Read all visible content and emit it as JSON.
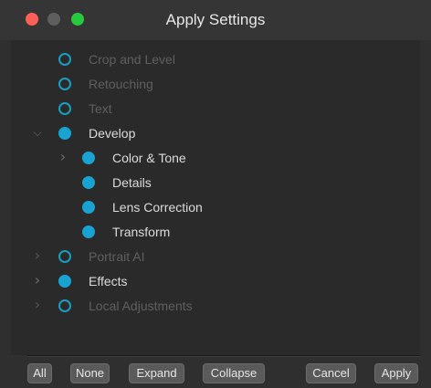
{
  "window": {
    "title": "Apply Settings"
  },
  "colors": {
    "accent": "#18a3d1",
    "close": "#ff5f57",
    "minimize_inactive": "#5e5e5e",
    "maximize": "#28c840"
  },
  "tree": {
    "items": [
      {
        "label": "Crop and Level",
        "state": "unchecked",
        "expander": "none",
        "enabled": false
      },
      {
        "label": "Retouching",
        "state": "unchecked",
        "expander": "none",
        "enabled": false
      },
      {
        "label": "Text",
        "state": "unchecked",
        "expander": "none",
        "enabled": false
      },
      {
        "label": "Develop",
        "state": "checked",
        "expander": "chevron-down-icon",
        "enabled": true
      },
      {
        "label": "Color & Tone",
        "state": "checked",
        "expander": "chevron-right-icon",
        "enabled": true,
        "level": 1
      },
      {
        "label": "Details",
        "state": "checked",
        "expander": "none",
        "enabled": true,
        "level": 1
      },
      {
        "label": "Lens Correction",
        "state": "checked",
        "expander": "none",
        "enabled": true,
        "level": 1
      },
      {
        "label": "Transform",
        "state": "checked",
        "expander": "none",
        "enabled": true,
        "level": 1
      },
      {
        "label": "Portrait AI",
        "state": "unchecked",
        "expander": "chevron-right-icon",
        "enabled": false
      },
      {
        "label": "Effects",
        "state": "checked",
        "expander": "chevron-right-icon",
        "enabled": true
      },
      {
        "label": "Local Adjustments",
        "state": "unchecked",
        "expander": "chevron-right-icon",
        "enabled": false
      }
    ]
  },
  "buttons": {
    "all": "All",
    "none": "None",
    "expand": "Expand",
    "collapse": "Collapse",
    "cancel": "Cancel",
    "apply": "Apply"
  },
  "glyphs": {
    "chevron_down": "⌵",
    "chevron_right": "›"
  }
}
